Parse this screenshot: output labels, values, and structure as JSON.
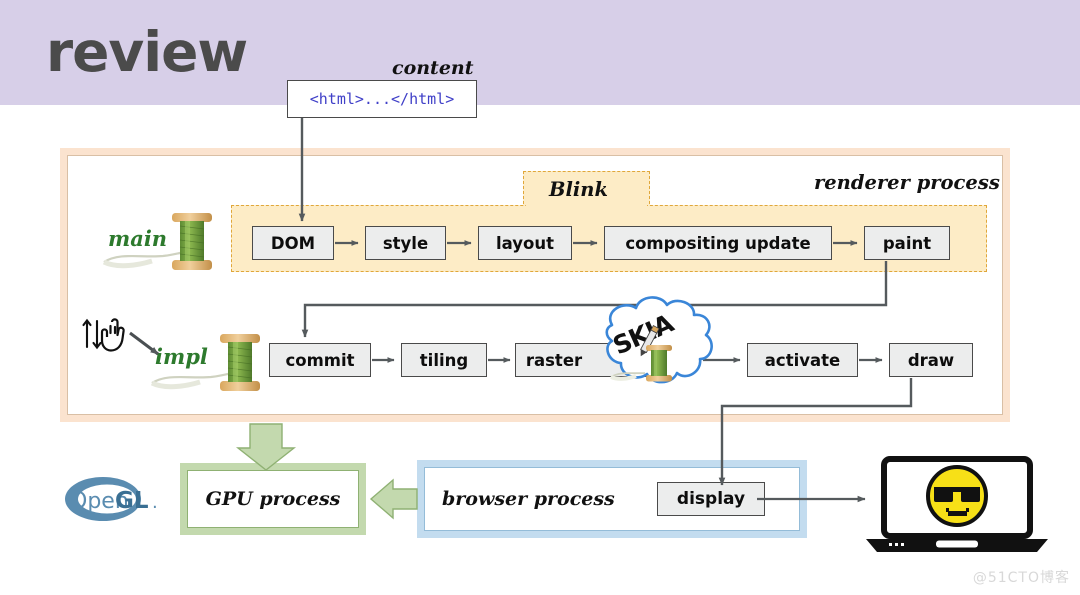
{
  "header": {
    "title": "review",
    "band_color": "#d7cfe8"
  },
  "content": {
    "label": "content",
    "code": "<html>...</html>"
  },
  "renderer": {
    "label": "renderer process",
    "border_color": "#fbe3cf"
  },
  "blink": {
    "label": "Blink",
    "fill_color": "#fdecc6",
    "border_color": "#e0a73a"
  },
  "threads": {
    "main": "main",
    "impl": "impl",
    "label_color": "#2d7a2d"
  },
  "main_pipeline": [
    {
      "label": "DOM"
    },
    {
      "label": "style"
    },
    {
      "label": "layout"
    },
    {
      "label": "compositing update"
    },
    {
      "label": "paint"
    }
  ],
  "impl_pipeline": [
    {
      "label": "commit"
    },
    {
      "label": "tiling"
    },
    {
      "label": "raster"
    },
    {
      "label": "activate"
    },
    {
      "label": "draw"
    }
  ],
  "skia": {
    "label": "SKIA",
    "cloud_color": "#3a86d8"
  },
  "gpu_process": {
    "label": "GPU process",
    "border_color": "#c3d9ae"
  },
  "browser_process": {
    "label": "browser process",
    "border_color": "#c3dcef",
    "display_label": "display"
  },
  "opengl": {
    "text_open": "Open",
    "text_gl": "GL",
    "text_dot": ".",
    "color": "#5a8cb0"
  },
  "device": {
    "name": "laptop",
    "screen_content": "cool-emoji"
  },
  "watermark": "@51CTO博客"
}
